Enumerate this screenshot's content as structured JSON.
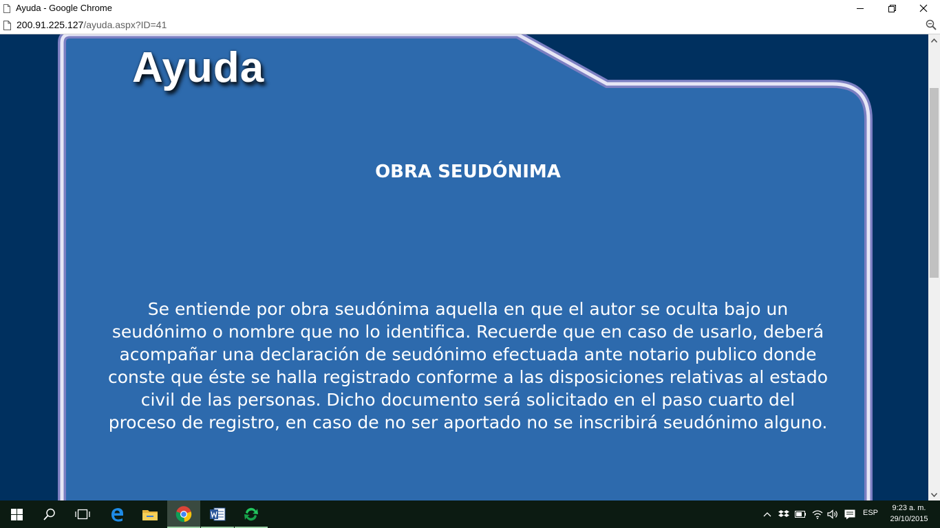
{
  "window": {
    "title": "Ayuda - Google Chrome",
    "url_host": "200.91.225.127",
    "url_path": "/ayuda.aspx?ID=41"
  },
  "page": {
    "heading": "Ayuda",
    "title": "OBRA SEUDÓNIMA",
    "body": "Se entiende por obra seudónima aquella en que el autor se oculta bajo un seudónimo o nombre que no lo identifica. Recuerde que en caso de usarlo, deberá acompañar una declaración de seudónimo efectuada ante notario publico donde conste que éste se halla registrado conforme a las disposiciones relativas al estado civil de las personas. Dicho documento será solicitado en el paso cuarto del proceso de registro, en caso de no ser aportado no se inscribirá seudónimo alguno."
  },
  "colors": {
    "page_background": "#00305f",
    "panel_fill": "#2d6aad",
    "panel_border": "#d8d8ee"
  },
  "taskbar": {
    "apps": [
      "windows-start",
      "search",
      "task-view",
      "edge",
      "file-explorer",
      "chrome",
      "word",
      "green-app"
    ],
    "tray": {
      "language": "ESP",
      "time": "9:23 a. m.",
      "date": "29/10/2015"
    }
  }
}
